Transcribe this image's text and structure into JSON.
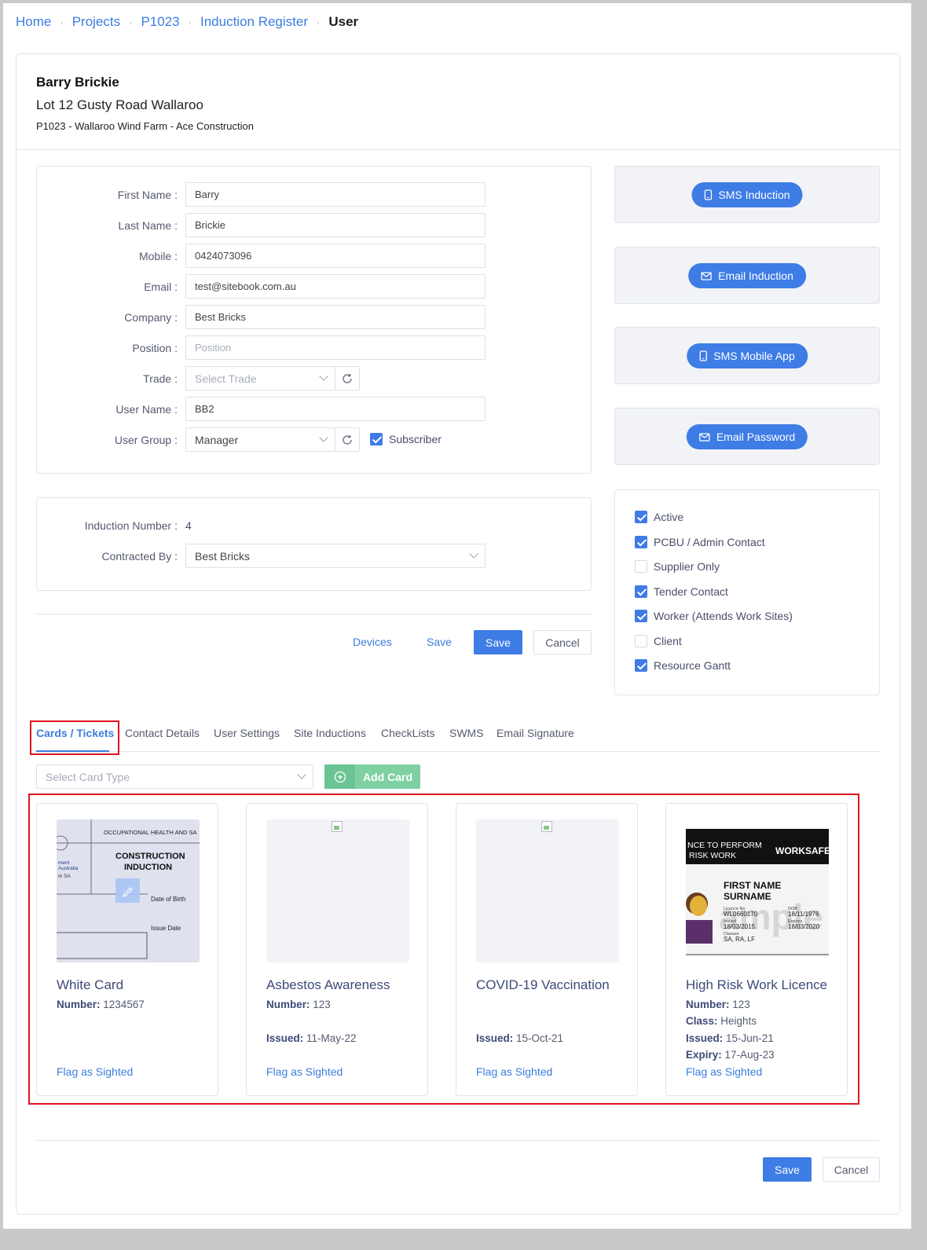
{
  "breadcrumb": {
    "items": [
      "Home",
      "Projects",
      "P1023",
      "Induction Register"
    ],
    "current": "User"
  },
  "header": {
    "name": "Barry Brickie",
    "address": "Lot 12 Gusty Road Wallaroo",
    "project": "P1023 - Wallaroo Wind Farm - Ace Construction"
  },
  "form": {
    "first_name": {
      "label": "First Name",
      "value": "Barry"
    },
    "last_name": {
      "label": "Last Name",
      "value": "Brickie"
    },
    "mobile": {
      "label": "Mobile",
      "value": "0424073096"
    },
    "email": {
      "label": "Email",
      "value": "test@sitebook.com.au"
    },
    "company": {
      "label": "Company",
      "value": "Best Bricks"
    },
    "position": {
      "label": "Position",
      "placeholder": "Position"
    },
    "trade": {
      "label": "Trade",
      "placeholder": "Select Trade"
    },
    "user_name": {
      "label": "User Name",
      "value": "BB2"
    },
    "user_group": {
      "label": "User Group",
      "value": "Manager"
    },
    "subscriber": {
      "label": "Subscriber",
      "checked": true
    }
  },
  "induction": {
    "number_label": "Induction Number",
    "number": "4",
    "contracted_label": "Contracted By",
    "contracted_value": "Best Bricks"
  },
  "actions": {
    "sms_induction": "SMS Induction",
    "email_induction": "Email Induction",
    "sms_mobile_app": "SMS Mobile App",
    "email_password": "Email Password"
  },
  "flags": [
    {
      "label": "Active",
      "checked": true
    },
    {
      "label": "PCBU / Admin Contact",
      "checked": true
    },
    {
      "label": "Supplier Only",
      "checked": false
    },
    {
      "label": "Tender Contact",
      "checked": true
    },
    {
      "label": "Worker (Attends Work Sites)",
      "checked": true
    },
    {
      "label": "Client",
      "checked": false
    },
    {
      "label": "Resource Gantt",
      "checked": true
    }
  ],
  "form_buttons": {
    "devices": "Devices",
    "save_link": "Save",
    "save": "Save",
    "cancel": "Cancel"
  },
  "tabs": [
    "Cards / Tickets",
    "Contact Details",
    "User Settings",
    "Site Inductions",
    "CheckLists",
    "SWMS",
    "Email Signature"
  ],
  "card_type": {
    "placeholder": "Select Card Type"
  },
  "add_card": "Add Card",
  "white_card_art": {
    "top": "OCCUPATIONAL HEALTH AND SA",
    "title1": "CONSTRUCTION",
    "title2": "INDUCTION",
    "left1": "ment",
    "left2": "Australia",
    "left3": "rk SA",
    "dob": "Date of Birth",
    "issue": "Issue Date"
  },
  "hrw_card_art": {
    "banner1": "NCE TO PERFORM",
    "banner2": "RISK WORK",
    "brand": "WORKSAFE",
    "name1": "FIRST NAME",
    "name2": "SURNAME",
    "watermark": "ample",
    "lic_label": "Licence No",
    "lic": "WL0660170",
    "issued_label": "Issued",
    "issued": "18/03/2015",
    "classes_label": "Classes",
    "classes": "SA, RA, LF",
    "dob_label": "DOB",
    "dob": "18/11/1976",
    "exp_label": "Expires",
    "exp": "18/03/2020"
  },
  "tickets": [
    {
      "title": "White Card",
      "number_label": "Number:",
      "number": "1234567",
      "flag": "Flag as Sighted"
    },
    {
      "title": "Asbestos Awareness",
      "number_label": "Number:",
      "number": "123",
      "issued_label": "Issued:",
      "issued": "11-May-22",
      "flag": "Flag as Sighted"
    },
    {
      "title": "COVID-19 Vaccination",
      "issued_label": "Issued:",
      "issued": "15-Oct-21",
      "flag": "Flag as Sighted"
    },
    {
      "title": "High Risk Work Licence",
      "number_label": "Number:",
      "number": "123",
      "class_label": "Class:",
      "class": "Heights",
      "issued_label": "Issued:",
      "issued": "15-Jun-21",
      "expiry_label": "Expiry:",
      "expiry": "17-Aug-23",
      "flag": "Flag as Sighted"
    }
  ],
  "footer_buttons": {
    "save": "Save",
    "cancel": "Cancel"
  },
  "colors": {
    "accent": "#3e7ce6",
    "link": "#3b7ddd",
    "highlight": "#e0141e",
    "add_card": "#7fd1a4"
  }
}
